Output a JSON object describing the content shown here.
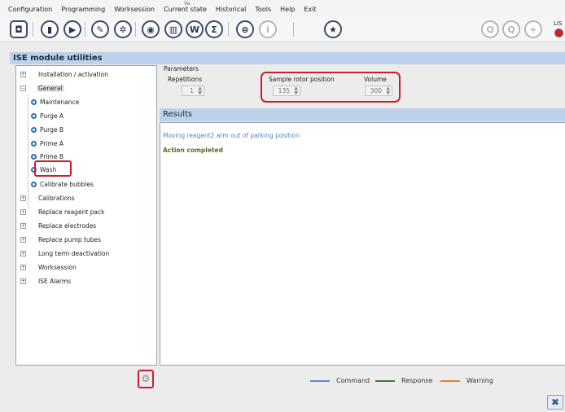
{
  "menu": {
    "items": [
      "Configuration",
      "Programming",
      "Worksession",
      "Current state",
      "Historical",
      "Tools",
      "Help",
      "Exit"
    ],
    "tiny_mark": "Va"
  },
  "toolbar": {
    "lis_label": "LIS",
    "lis_status_color": "#d81e1e"
  },
  "window": {
    "title": "ISE module utilities"
  },
  "tree": {
    "root_items": [
      "Installation / activation",
      "General",
      "Calibrations",
      "Replace reagent pack",
      "Replace electrodes",
      "Replace pump tubes",
      "Long term deactivation",
      "Worksession",
      "ISE Alarms"
    ],
    "general_children": [
      "Maintenance",
      "Purge A",
      "Purge B",
      "Prime A",
      "Prime B",
      "Wash",
      "Calibrate bubbles"
    ],
    "selected": "Wash"
  },
  "parameters": {
    "title": "Parameters",
    "repetitions": {
      "label": "Repetitions",
      "value": "1"
    },
    "sample_rotor_position": {
      "label": "Sample rotor position",
      "value": "135"
    },
    "volume": {
      "label": "Volume",
      "value": "300"
    }
  },
  "results": {
    "title": "Results",
    "lines": [
      "Moving reagent2 arm out of parking position",
      "Action completed"
    ]
  },
  "legend": {
    "items": [
      {
        "label": "Command",
        "color": "#5b8fd0"
      },
      {
        "label": "Response",
        "color": "#3f7a2a"
      },
      {
        "label": "Warning",
        "color": "#f07a2a"
      }
    ]
  },
  "colors": {
    "accent_band": "#bdd1ea",
    "annotation_red": "#c8202a"
  }
}
